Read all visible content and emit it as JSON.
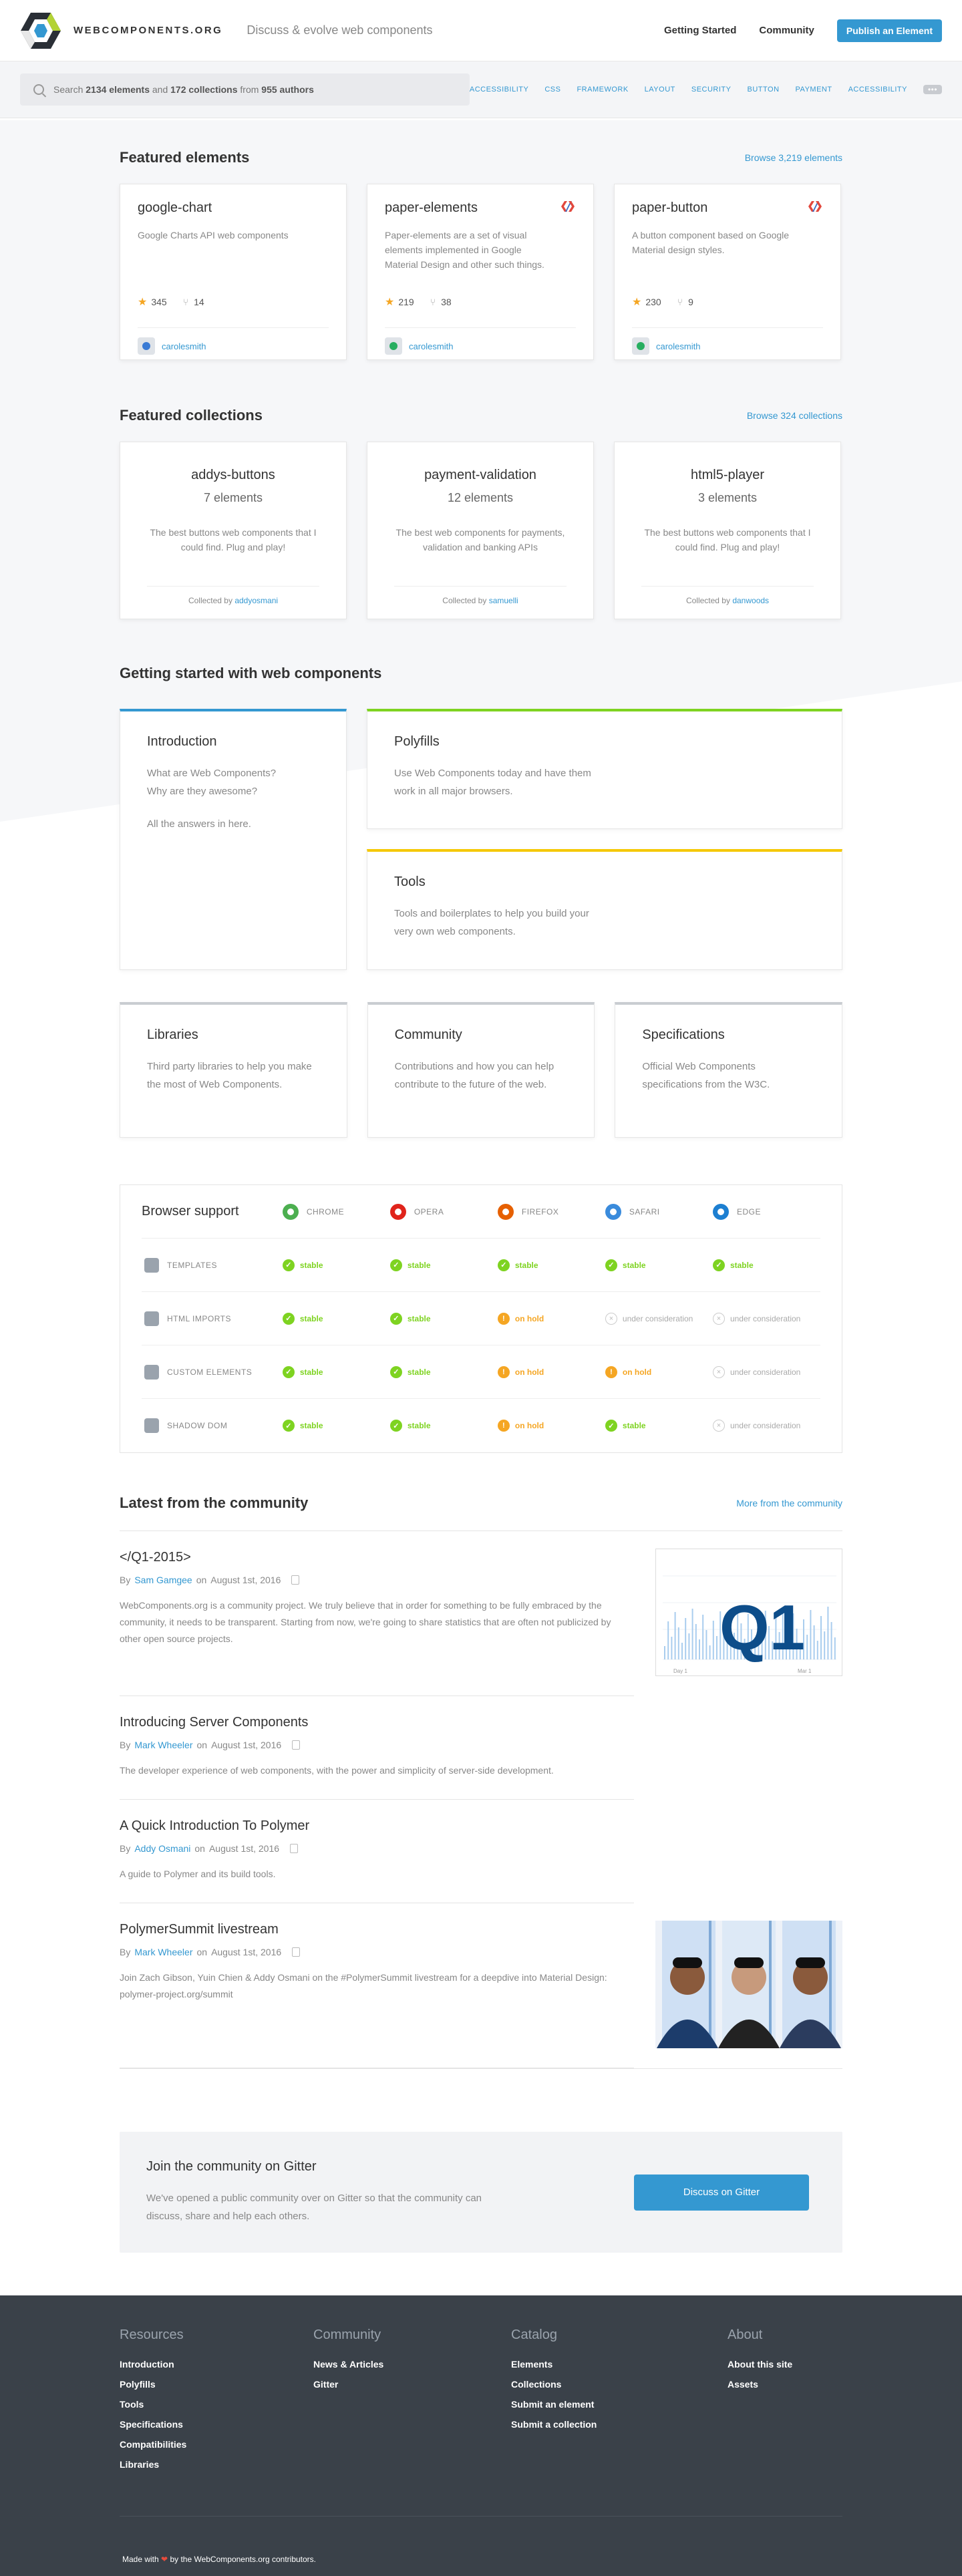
{
  "header": {
    "brand": "WEBCOMPONENTS.ORG",
    "tagline": "Discuss & evolve web components",
    "nav": {
      "getting_started": "Getting Started",
      "community": "Community",
      "publish": "Publish an Element"
    }
  },
  "search": {
    "prefix": "Search",
    "elements": "2134 elements",
    "and": "and",
    "collections": "172 collections",
    "from": "from",
    "authors": "955 authors",
    "tags": [
      "ACCESSIBILITY",
      "CSS",
      "FRAMEWORK",
      "LAYOUT",
      "SECURITY",
      "BUTTON",
      "PAYMENT",
      "ACCESSIBILITY"
    ],
    "more": "•••"
  },
  "featured_elements": {
    "title": "Featured elements",
    "link": "Browse 3,219 elements",
    "items": [
      {
        "name": "google-chart",
        "desc": "Google Charts API web components",
        "stars": "345",
        "forks": "14",
        "author": "carolesmith",
        "avatar_color": "#3a7bd5",
        "polymer": false
      },
      {
        "name": "paper-elements",
        "desc": "Paper-elements are a set of visual elements implemented in Google Material Design and other such things.",
        "stars": "219",
        "forks": "38",
        "author": "carolesmith",
        "avatar_color": "#27ae60",
        "polymer": true
      },
      {
        "name": "paper-button",
        "desc": "A button component based on Google Material design styles.",
        "stars": "230",
        "forks": "9",
        "author": "carolesmith",
        "avatar_color": "#27ae60",
        "polymer": true
      }
    ]
  },
  "featured_collections": {
    "title": "Featured collections",
    "link": "Browse 324 collections",
    "collected_by": "Collected by",
    "items": [
      {
        "name": "addys-buttons",
        "count": "7 elements",
        "desc": "The best buttons web components that I could find. Plug and play!",
        "by": "addyosmani"
      },
      {
        "name": "payment-validation",
        "count": "12 elements",
        "desc": "The best web components for payments, validation and banking APIs",
        "by": "samuelli"
      },
      {
        "name": "html5-player",
        "count": "3 elements",
        "desc": "The best buttons web components that I could find. Plug and play!",
        "by": "danwoods"
      }
    ]
  },
  "getting_started": {
    "title": "Getting started with web components",
    "intro": {
      "title": "Introduction",
      "text1": "What are Web Components? Why are they awesome?",
      "text2": "All the answers in here."
    },
    "polyfills": {
      "title": "Polyfills",
      "text": "Use Web Components today and have them work in all major browsers."
    },
    "tools": {
      "title": "Tools",
      "text": "Tools and boilerplates to help you build your very own web components."
    },
    "libraries": {
      "title": "Libraries",
      "text": "Third party libraries to help you make the most of Web Components."
    },
    "community": {
      "title": "Community",
      "text": "Contributions and how you can help contribute to the future of the web."
    },
    "specifications": {
      "title": "Specifications",
      "text": "Official Web Components specifications from the W3C."
    }
  },
  "browser_support": {
    "title": "Browser support",
    "browsers": [
      {
        "name": "CHROME",
        "icon": "chrome-icon",
        "color": "#4caf50"
      },
      {
        "name": "OPERA",
        "icon": "opera-icon",
        "color": "#e0241b"
      },
      {
        "name": "FIREFOX",
        "icon": "firefox-icon",
        "color": "#e66000"
      },
      {
        "name": "SAFARI",
        "icon": "safari-icon",
        "color": "#3a8bdc"
      },
      {
        "name": "EDGE",
        "icon": "edge-icon",
        "color": "#1d7fd1"
      }
    ],
    "features": [
      {
        "name": "TEMPLATES",
        "icon": "templates-icon",
        "status": [
          {
            "s": "stable",
            "label": "stable"
          },
          {
            "s": "stable",
            "label": "stable"
          },
          {
            "s": "stable",
            "label": "stable"
          },
          {
            "s": "stable",
            "label": "stable"
          },
          {
            "s": "stable",
            "label": "stable"
          }
        ]
      },
      {
        "name": "HTML IMPORTS",
        "icon": "html-imports-icon",
        "status": [
          {
            "s": "stable",
            "label": "stable"
          },
          {
            "s": "stable",
            "label": "stable"
          },
          {
            "s": "hold",
            "label": "on hold"
          },
          {
            "s": "cons",
            "label": "under consideration"
          },
          {
            "s": "cons",
            "label": "under consideration"
          }
        ]
      },
      {
        "name": "CUSTOM ELEMENTS",
        "icon": "custom-elements-icon",
        "status": [
          {
            "s": "stable",
            "label": "stable"
          },
          {
            "s": "stable",
            "label": "stable"
          },
          {
            "s": "hold",
            "label": "on hold"
          },
          {
            "s": "hold",
            "label": "on hold"
          },
          {
            "s": "cons",
            "label": "under consideration"
          }
        ]
      },
      {
        "name": "SHADOW DOM",
        "icon": "shadow-dom-icon",
        "status": [
          {
            "s": "stable",
            "label": "stable"
          },
          {
            "s": "stable",
            "label": "stable"
          },
          {
            "s": "hold",
            "label": "on hold"
          },
          {
            "s": "stable",
            "label": "stable"
          },
          {
            "s": "cons",
            "label": "under consideration"
          }
        ]
      }
    ]
  },
  "community": {
    "title": "Latest from the community",
    "link": "More from the community",
    "by": "By",
    "on": "on",
    "posts": [
      {
        "title": "</Q1-2015>",
        "author": "Sam Gamgee",
        "date": "August 1st, 2016",
        "text": "WebComponents.org is a community project. We truly believe that in order for something to be fully embraced by the community, it needs to be transparent. Starting from now, we're going to share statistics that are often not publicized by other open source projects.",
        "thumb": "Q1",
        "chart_labels": [
          "Day 1",
          "Mar 1"
        ]
      },
      {
        "title": "Introducing Server Components",
        "author": "Mark Wheeler",
        "date": "August 1st, 2016",
        "text": "The developer experience of web components, with the power and simplicity of server-side development."
      },
      {
        "title": "A Quick Introduction To Polymer",
        "author": "Addy Osmani",
        "date": "August 1st, 2016",
        "text": "A guide to Polymer and its build tools."
      },
      {
        "title": "PolymerSummit livestream",
        "author": "Mark Wheeler",
        "date": "August 1st, 2016",
        "text": "Join Zach Gibson, Yuin Chien & Addy Osmani on the #PolymerSummit livestream for a deepdive into Material Design: polymer-project.org/summit"
      }
    ]
  },
  "gitter": {
    "title": "Join the community on Gitter",
    "text": "We've opened a public community over on Gitter so that the community can discuss, share and help each others.",
    "button": "Discuss on Gitter"
  },
  "footer": {
    "columns": [
      {
        "title": "Resources",
        "links": [
          "Introduction",
          "Polyfills",
          "Tools",
          "Specifications",
          "Compatibilities",
          "Libraries"
        ]
      },
      {
        "title": "Community",
        "links": [
          "News & Articles",
          "Gitter"
        ]
      },
      {
        "title": "Catalog",
        "links": [
          "Elements",
          "Collections",
          "Submit an element",
          "Submit a collection"
        ]
      },
      {
        "title": "About",
        "links": [
          "About this site",
          "Assets"
        ]
      }
    ],
    "made_prefix": "Made with",
    "heart": "❤",
    "made_suffix": "by the WebComponents.org contributors."
  }
}
